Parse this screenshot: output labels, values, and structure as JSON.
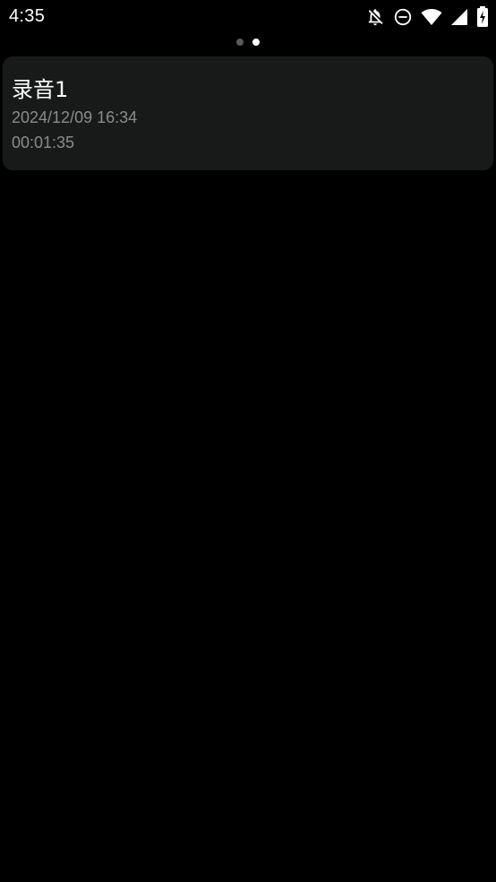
{
  "status_bar": {
    "time": "4:35",
    "icons": [
      "notifications-off-icon",
      "do-not-disturb-icon",
      "wifi-icon",
      "signal-icon",
      "battery-charging-icon"
    ]
  },
  "pager": {
    "pages": 2,
    "active_index": 1
  },
  "recordings": [
    {
      "title": "录音1",
      "date": "2024/12/09 16:34",
      "duration": "00:01:35"
    }
  ],
  "colors": {
    "background": "#000000",
    "card": "#181a1a",
    "primary_text": "#ffffff",
    "secondary_text": "#8a8c8c",
    "dot_inactive": "#5a5a5a",
    "dot_active": "#ffffff"
  }
}
